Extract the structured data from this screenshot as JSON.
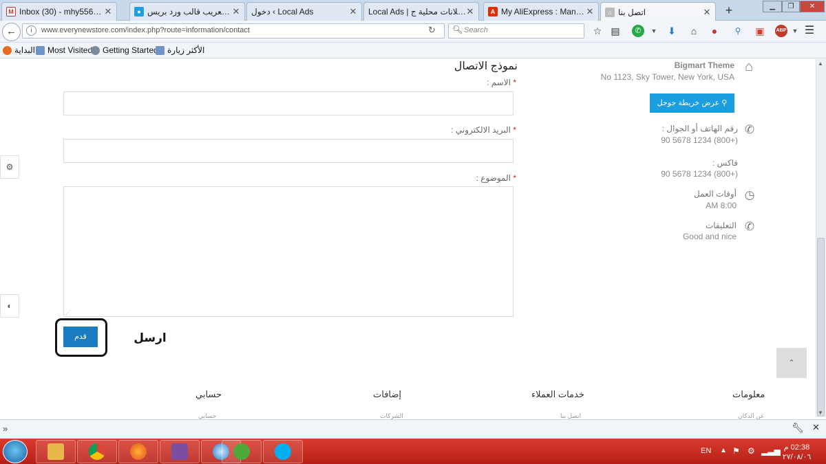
{
  "tabs": [
    {
      "label": "Inbox (30) - mhy5566@...",
      "icon": "gmail-icon",
      "color": "#d93025"
    },
    {
      "label": "تعريب قالب ورد بريس ...",
      "icon": "site-icon",
      "color": "#1ba1e2"
    },
    {
      "label": "دخول ‹ Local Ads",
      "icon": "none",
      "color": ""
    },
    {
      "label": "Local Ads | اعلانات محلية ج...",
      "icon": "none",
      "color": ""
    },
    {
      "label": "My AliExpress : Manage ...",
      "icon": "aliexpress-icon",
      "color": "#e62e04"
    },
    {
      "label": "اتصل بنا",
      "icon": "cart-icon",
      "color": "#8a8a8a"
    }
  ],
  "navbar": {
    "url": "www.everynewstore.com/index.php?route=information/contact",
    "search_placeholder": "Search"
  },
  "bookmarks": [
    {
      "label": "البداية",
      "icon": "firefox-icon"
    },
    {
      "label": "Most Visited",
      "icon": "bookmark-icon"
    },
    {
      "label": "Getting Started",
      "icon": "globe-icon"
    },
    {
      "label": "الأكثر زيارة",
      "icon": "bookmark-icon"
    }
  ],
  "form": {
    "title": "نموذج الاتصال",
    "name_label": "الاسم :",
    "email_label": "البريد الالكتروني :",
    "subject_label": "الموضوع :",
    "required_mark": "*",
    "submit_label": "قدم",
    "annotation": "ارسل"
  },
  "contact": {
    "company": "Bigmart Theme",
    "address": "No 1123, Sky Tower, New York, USA",
    "map_button": "عرض خريطة جوجل",
    "phone_label": "رقم الهاتف أو الجوال :",
    "phone_value": "90 5678 1234 (800+)",
    "fax_label": "فاكس :",
    "fax_value": "90 5678 1234 (800+)",
    "hours_label": "أوقات العمل",
    "hours_value": "AM 8:00",
    "comments_label": "التعليقات",
    "comments_value": "Good and nice",
    "accent": "#1a9ee0"
  },
  "footer": {
    "columns": [
      {
        "title": "معلومات",
        "item": "عن الدكان"
      },
      {
        "title": "خدمات العملاء",
        "item": "اتصل بنا"
      },
      {
        "title": "إضافات",
        "item": "الشركات"
      },
      {
        "title": "حسابي",
        "item": "حسابي"
      }
    ]
  },
  "taskbar": {
    "lang": "EN",
    "time": "02:38 م",
    "date": "٢٧/٠٨/٠٦",
    "apps": [
      "explorer-icon",
      "chrome-icon",
      "firefox-icon",
      "media-icon",
      "network-icon",
      "utorrent-icon",
      "skype-icon"
    ]
  }
}
